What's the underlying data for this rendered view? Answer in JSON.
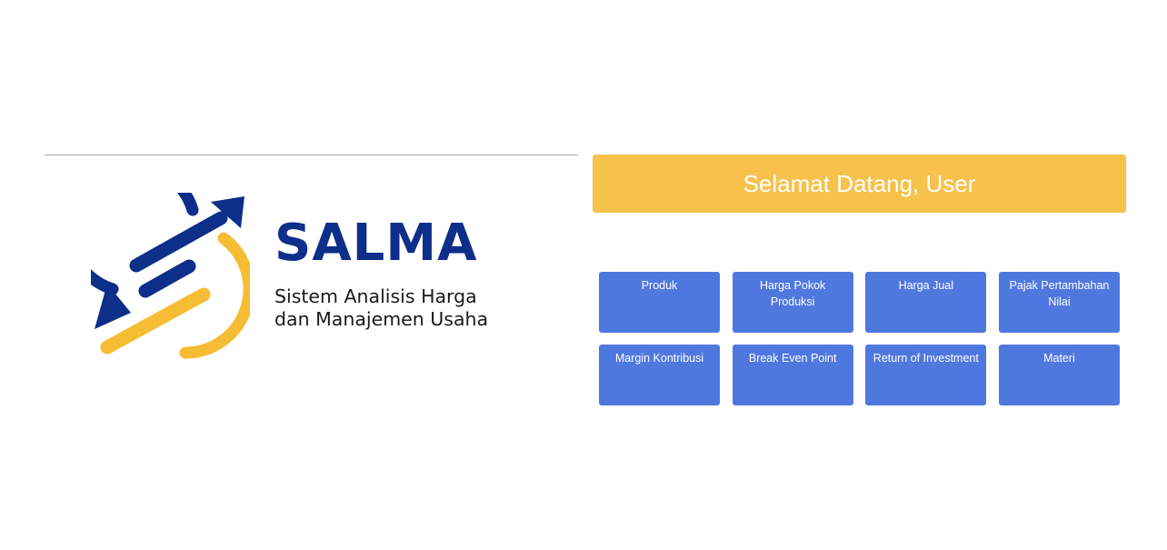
{
  "brand": {
    "name": "SALMA",
    "tagline_line1": "Sistem Analisis Harga",
    "tagline_line2": "dan Manajemen Usaha",
    "colors": {
      "navy": "#0d2f8a",
      "gold": "#f6bc33"
    }
  },
  "welcome": {
    "text": "Selamat Datang, User",
    "background": "#f6c24c"
  },
  "menu": {
    "tile_color": "#4f78df",
    "items": [
      {
        "label": "Produk"
      },
      {
        "label": "Harga Pokok Produksi"
      },
      {
        "label": "Harga Jual"
      },
      {
        "label": "Pajak Pertambahan Nilai"
      },
      {
        "label": "Margin Kontribusi"
      },
      {
        "label": "Break Even Point"
      },
      {
        "label": "Return of Investment"
      },
      {
        "label": "Materi"
      }
    ]
  }
}
